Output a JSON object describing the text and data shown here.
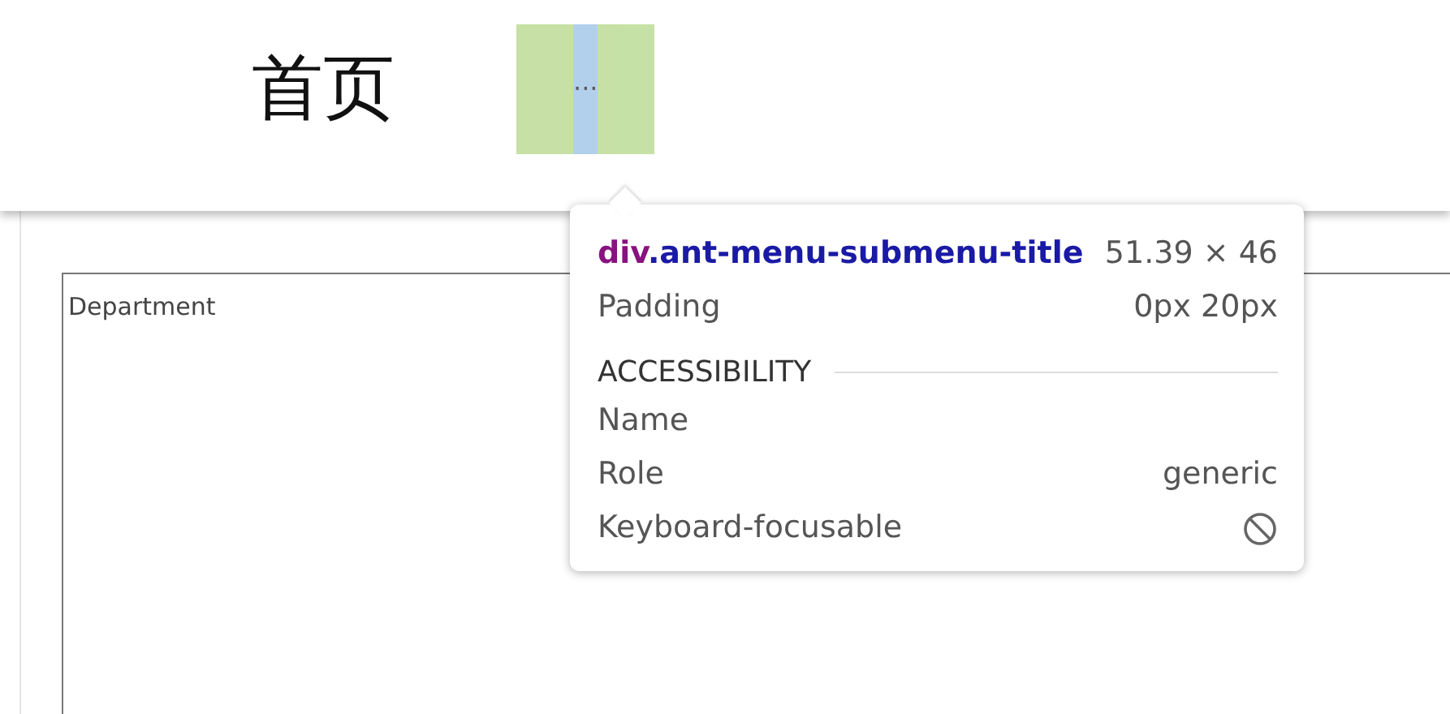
{
  "menu": {
    "items": [
      {
        "label": "首页",
        "highlighted": false
      },
      {
        "label": "···",
        "highlighted": true
      }
    ]
  },
  "panel": {
    "field_label": "Department"
  },
  "tooltip": {
    "tag": "div",
    "class_name": ".ant-menu-submenu-title",
    "size": "51.39 × 46",
    "rows": [
      {
        "label": "Padding",
        "value": "0px 20px"
      }
    ],
    "section_title": "ACCESSIBILITY",
    "accessibility": [
      {
        "label": "Name",
        "kind": "text"
      },
      {
        "label": "Role",
        "kind": "text",
        "value": "generic"
      },
      {
        "label": "Keyboard-focusable",
        "kind": "flag",
        "focusable": false
      }
    ]
  }
}
